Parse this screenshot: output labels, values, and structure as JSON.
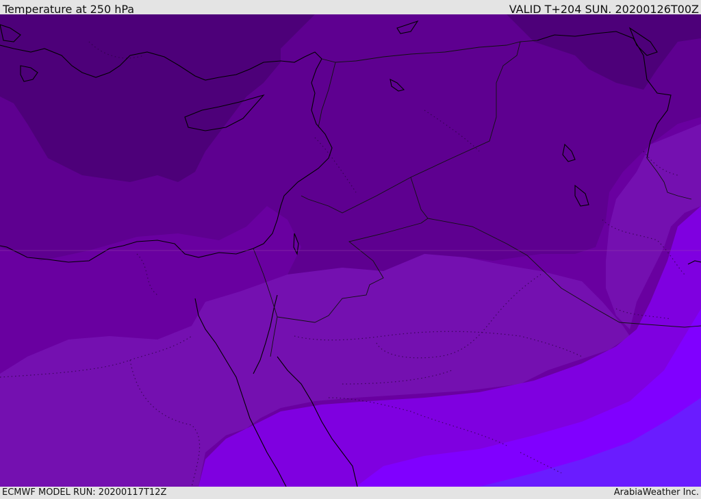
{
  "header": {
    "title": "Temperature at 250 hPa",
    "valid": "VALID T+204 SUN. 20200126T00Z"
  },
  "footer": {
    "model_run": "ECMWF MODEL RUN: 20200117T12Z",
    "credit": "ArabiaWeather Inc."
  },
  "colors": {
    "band_1_coldest": "#4d0079",
    "band_2": "#5e0090",
    "band_3": "#6900a0",
    "band_4": "#7410b0",
    "band_5": "#7f00e0",
    "band_6": "#8000ff",
    "band_7_warmest": "#6a1cff",
    "coastline": "#000000",
    "border": "#000000",
    "chrome": "#e4e4e4"
  }
}
